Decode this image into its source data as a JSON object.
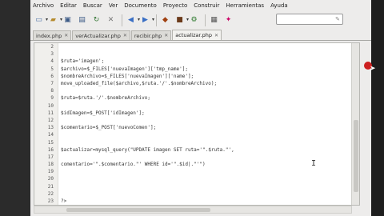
{
  "menu": [
    "Archivo",
    "Editar",
    "Buscar",
    "Ver",
    "Documento",
    "Proyecto",
    "Construir",
    "Herramientas",
    "Ayuda"
  ],
  "toolbar": {
    "icons": [
      "new-file-icon",
      "open-file-icon",
      "save-icon",
      "save-all-icon",
      "revert-icon",
      "close-icon",
      "back-icon",
      "forward-icon",
      "compile-icon",
      "build-icon",
      "run-icon",
      "preferences-icon",
      "color-chooser-icon"
    ],
    "search_placeholder": "",
    "search_btn": "✎"
  },
  "tabs": [
    {
      "label": "index.php",
      "active": false
    },
    {
      "label": "verActualizar.php",
      "active": false
    },
    {
      "label": "recibir.php",
      "active": false
    },
    {
      "label": "actualizar.php",
      "active": true
    }
  ],
  "editor": {
    "lines": [
      {
        "n": "2",
        "t": ""
      },
      {
        "n": "3",
        "t": ""
      },
      {
        "n": "4",
        "t": "$ruta='imagen';"
      },
      {
        "n": "5",
        "t": "$archivo=$_FILES['nuevaImagen']['tmp_name'];"
      },
      {
        "n": "6",
        "t": "$nombreArchivo=$_FILES['nuevaImagen']['name'];"
      },
      {
        "n": "7",
        "t": "move_uploaded_file($archivo,$ruta.'/'.$nombreArchivo);"
      },
      {
        "n": "8",
        "t": ""
      },
      {
        "n": "9",
        "t": "$ruta=$ruta.'/'.$nombreArchivo;"
      },
      {
        "n": "10",
        "t": ""
      },
      {
        "n": "11",
        "t": "$idImagen=$_POST['idImagen'];"
      },
      {
        "n": "12",
        "t": ""
      },
      {
        "n": "13",
        "t": "$comentario=$_POST['nuevoComen'];"
      },
      {
        "n": "14",
        "t": ""
      },
      {
        "n": "15",
        "t": ""
      },
      {
        "n": "16",
        "t": "$actualizar=mysql_query(\"UPDATE imagen SET ruta='\".$ruta.\"',"
      },
      {
        "n": "17",
        "t": ""
      },
      {
        "n": "18",
        "t": "comentario='\".$comentario.\"' WHERE id='\".$id|.\"'\")"
      },
      {
        "n": "19",
        "t": ""
      },
      {
        "n": "20",
        "t": ""
      },
      {
        "n": "21",
        "t": ""
      },
      {
        "n": "22",
        "t": ""
      },
      {
        "n": "23",
        "t": "?>"
      }
    ]
  }
}
